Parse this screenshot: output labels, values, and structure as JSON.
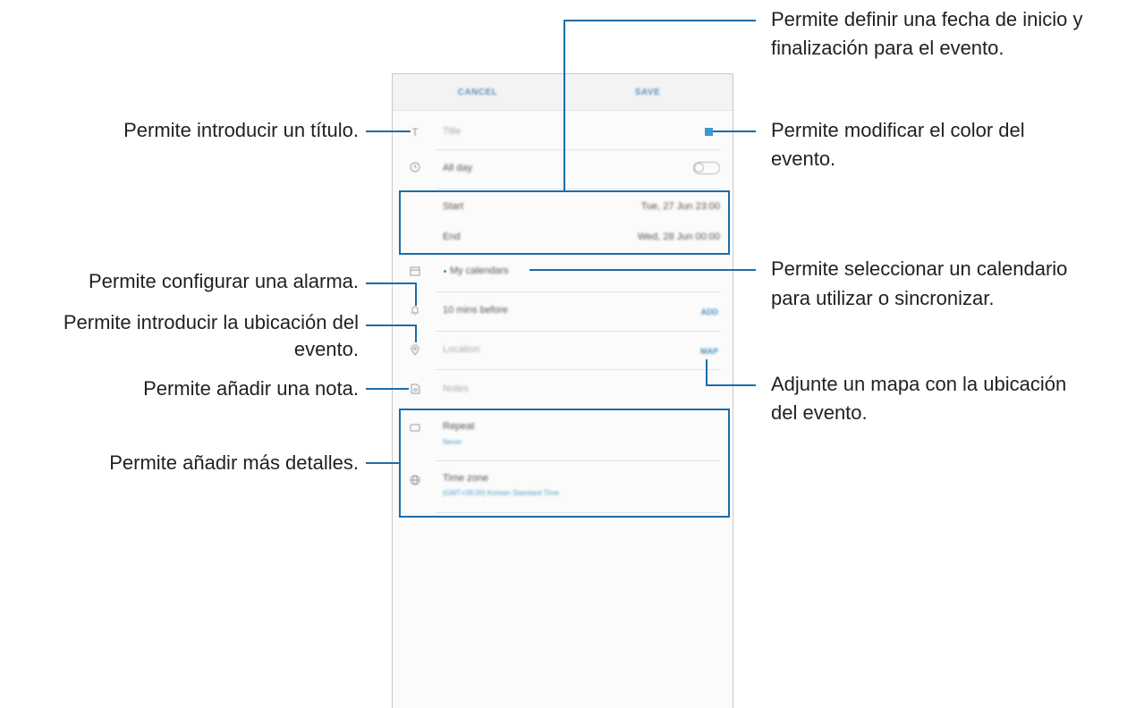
{
  "phone": {
    "topbar": {
      "cancel": "CANCEL",
      "save": "SAVE"
    },
    "rows": {
      "title_placeholder": "Title",
      "all_day": "All day",
      "start_label": "Start",
      "start_value": "Tue, 27 Jun   23:00",
      "end_label": "End",
      "end_value": "Wed, 28 Jun   00:00",
      "calendar": "My calendars",
      "reminder": "10 mins before",
      "reminder_action": "ADD",
      "location_placeholder": "Location",
      "location_action": "MAP",
      "notes_placeholder": "Notes",
      "repeat_label": "Repeat",
      "repeat_value": "Never",
      "timezone_label": "Time zone",
      "timezone_value": "(GMT+09:00) Korean Standard Time"
    },
    "icons": {
      "title": "text-icon",
      "all_day": "clock-icon",
      "calendar": "calendar-icon",
      "reminder": "bell-icon",
      "location": "location-pin-icon",
      "notes": "note-icon",
      "repeat": "repeat-icon",
      "timezone": "globe-icon"
    },
    "accent_color": "#3d97d1"
  },
  "annotations": {
    "title": "Permite introducir un título.",
    "date_line1": "Permite definir una fecha de inicio y",
    "date_line2": "finalización para el evento.",
    "color_line1": "Permite modificar el color del",
    "color_line2": "evento.",
    "alarm": "Permite configurar una alarma.",
    "calendar_line1": "Permite seleccionar un calendario",
    "calendar_line2": "para utilizar o sincronizar.",
    "location_line1": "Permite introducir la ubicación del",
    "location_line2": "evento.",
    "map_line1": "Adjunte un mapa con la ubicación",
    "map_line2": "del evento.",
    "note": "Permite añadir una nota.",
    "details": "Permite añadir más detalles."
  },
  "colors": {
    "leader": "#1b6da6",
    "text": "#231f20"
  }
}
